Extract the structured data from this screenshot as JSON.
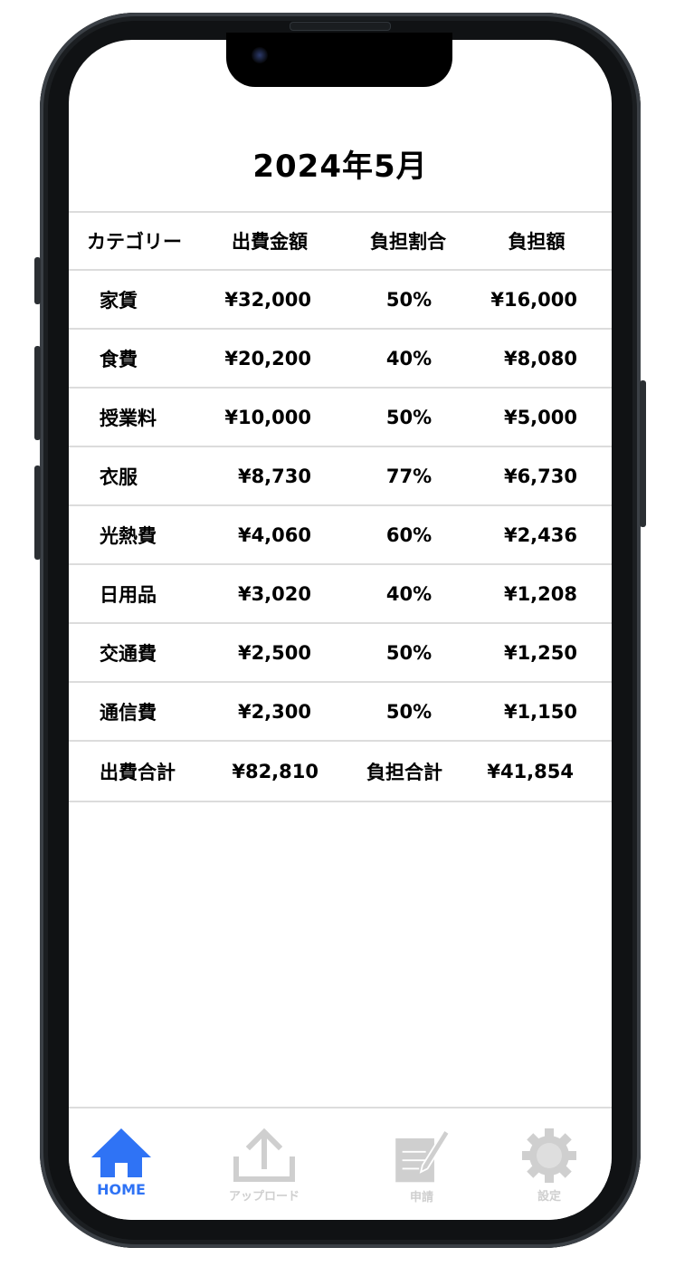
{
  "page": {
    "title": "2024年5月"
  },
  "table": {
    "headers": [
      "カテゴリー",
      "出費金額",
      "負担割合",
      "負担額"
    ],
    "rows": [
      {
        "category": "家賃",
        "expense": "¥32,000",
        "ratio": "50%",
        "share": "¥16,000"
      },
      {
        "category": "食費",
        "expense": "¥20,200",
        "ratio": "40%",
        "share": "¥8,080"
      },
      {
        "category": "授業料",
        "expense": "¥10,000",
        "ratio": "50%",
        "share": "¥5,000"
      },
      {
        "category": "衣服",
        "expense": "¥8,730",
        "ratio": "77%",
        "share": "¥6,730"
      },
      {
        "category": "光熱費",
        "expense": "¥4,060",
        "ratio": "60%",
        "share": "¥2,436"
      },
      {
        "category": "日用品",
        "expense": "¥3,020",
        "ratio": "40%",
        "share": "¥1,208"
      },
      {
        "category": "交通費",
        "expense": "¥2,500",
        "ratio": "50%",
        "share": "¥1,250"
      },
      {
        "category": "通信費",
        "expense": "¥2,300",
        "ratio": "50%",
        "share": "¥1,150"
      }
    ],
    "totals": {
      "expense_label": "出費合計",
      "expense_value": "¥82,810",
      "share_label": "負担合計",
      "share_value": "¥41,854"
    }
  },
  "tabbar": {
    "items": [
      {
        "label": "HOME",
        "icon": "home-icon",
        "active": true
      },
      {
        "label": "アップロード",
        "icon": "upload-icon",
        "active": false
      },
      {
        "label": "申請",
        "icon": "document-edit-icon",
        "active": false
      },
      {
        "label": "設定",
        "icon": "gear-icon",
        "active": false
      }
    ],
    "active_color": "#2f73f5",
    "inactive_color": "#cfcfcf"
  }
}
